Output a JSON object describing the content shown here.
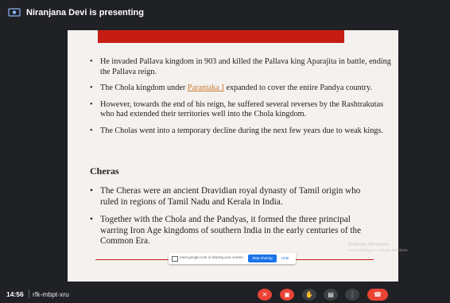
{
  "header": {
    "presenter_text": "Niranjana Devi is presenting"
  },
  "slide": {
    "bullets": [
      "He invaded Pallava kingdom in 903 and killed the Pallava king Aparajita in battle, ending the Pallava reign.",
      {
        "pre": "The Chola kingdom under ",
        "link": "Parantaka I",
        "post": " expanded to cover the entire Pandya country."
      },
      "However, towards the end of his reign, he suffered several reverses by the Rashtrakutas who had extended their territories well into the Chola kingdom.",
      "The Cholas went into a temporary decline during the next few years due to weak kings."
    ],
    "section_title": "Cheras",
    "bullets2": [
      "The Cheras were an ancient Dravidian royal dynasty of Tamil origin who ruled in regions of Tamil Nadu and Kerala in India.",
      "Together with the Chola and the Pandyas, it formed the three principal warring Iron Age kingdoms of southern India in the early centuries of the Common Era."
    ],
    "header_color": "#c51d14"
  },
  "share_banner": {
    "text": "meet.google.com is sharing your screen.",
    "stop_label": "Stop sharing",
    "hide_label": "Hide"
  },
  "watermark": {
    "line1": "Activate Windows",
    "line2": "Go to Settings to activate Windows."
  },
  "bottom_bar": {
    "time": "14:56",
    "meeting_code": "rfk-mbpt-xru",
    "controls": [
      {
        "name": "microphone-off-icon",
        "glyph": "✕",
        "style": "red"
      },
      {
        "name": "camera-off-icon",
        "glyph": "▣",
        "style": "red"
      },
      {
        "name": "raise-hand-icon",
        "glyph": "✋",
        "style": "grey"
      },
      {
        "name": "present-screen-icon",
        "glyph": "▤",
        "style": "grey"
      },
      {
        "name": "more-options-icon",
        "glyph": "⋮",
        "style": "grey"
      },
      {
        "name": "end-call-icon",
        "glyph": "☎",
        "style": "red end"
      }
    ]
  }
}
